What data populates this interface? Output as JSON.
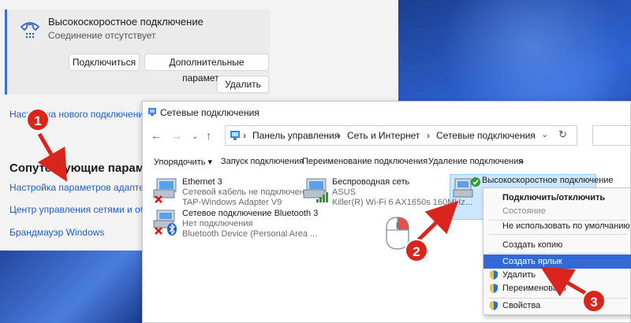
{
  "settings": {
    "connection": {
      "title": "Высокоскоростное подключение",
      "status": "Соединение отсутствует",
      "connect_label": "Подключиться",
      "advanced_label": "Дополнительные параметры",
      "delete_label": "Удалить"
    },
    "new_connection_link": "Настройка нового подключения",
    "related_title": "Сопутствующие параметры",
    "links": [
      "Настройка параметров адаптера",
      "Центр управления сетями и общим доступом",
      "Брандмауэр Windows"
    ]
  },
  "window": {
    "title": "Сетевые подключения",
    "nav": {
      "back": "←",
      "forward": "→",
      "up": "↑"
    },
    "breadcrumb": [
      "Панель управления",
      "Сеть и Интернет",
      "Сетевые подключения"
    ],
    "toolbar": {
      "organize": "Упорядочить ▾",
      "start": "Запуск подключения",
      "rename": "Переименование подключения",
      "delete": "Удаление подключения",
      "more": "»"
    },
    "items": [
      {
        "name": "Ethernet 3",
        "line1": "Сетевой кабель не подключен",
        "line2": "TAP-Windows Adapter V9"
      },
      {
        "name": "Беспроводная сеть",
        "line1": "ASUS",
        "line2": "Killer(R) Wi-Fi 6 AX1650s 160MHz..."
      },
      {
        "name": "Высокоскоростное подключение",
        "line1": "",
        "line2": ""
      },
      {
        "name": "Сетевое подключение Bluetooth 3",
        "line1": "Нет подключения",
        "line2": "Bluetooth Device (Personal Area ..."
      }
    ]
  },
  "context_menu": {
    "items": [
      "Подключить/отключить",
      "Состояние",
      "Не использовать по умолчанию",
      "Создать копию",
      "Создать ярлык",
      "Удалить",
      "Переименовать",
      "Свойства"
    ]
  },
  "annotations": {
    "steps": [
      "1",
      "2",
      "3"
    ],
    "color": "#d9251c"
  },
  "colors": {
    "accent": "#3369d6",
    "link": "#1d5cc9",
    "selection": "#cce8ff"
  }
}
